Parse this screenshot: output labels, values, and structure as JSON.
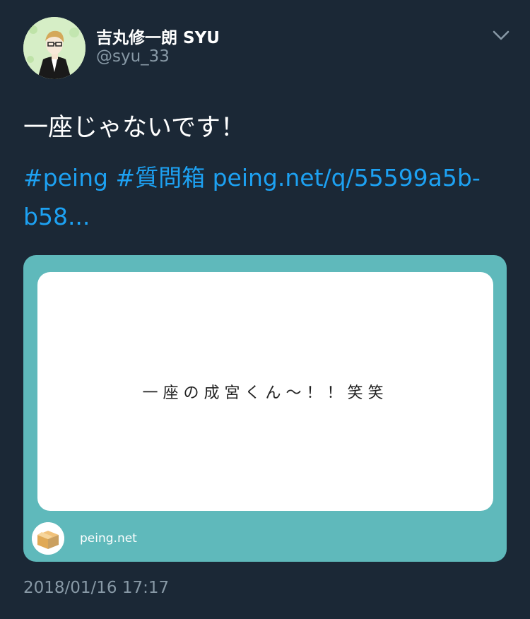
{
  "author": {
    "display_name": "吉丸修一朗 SYU",
    "handle": "@syu_33",
    "avatar_icon": "user-avatar"
  },
  "tweet": {
    "text": "一座じゃないです！",
    "hashtags": [
      "#peing",
      "#質問箱"
    ],
    "link_line1": "peing.net/q/55599a5b-",
    "link_line2": "b58..."
  },
  "card": {
    "question": "一座の成宮くん〜！！笑笑",
    "domain": "peing.net",
    "icon": "peing-box-icon",
    "background_color": "#5fb9bb"
  },
  "timestamp": "2018/01/16 17:17",
  "colors": {
    "background": "#1b2836",
    "link": "#1da1f2",
    "muted": "#8899a6"
  }
}
